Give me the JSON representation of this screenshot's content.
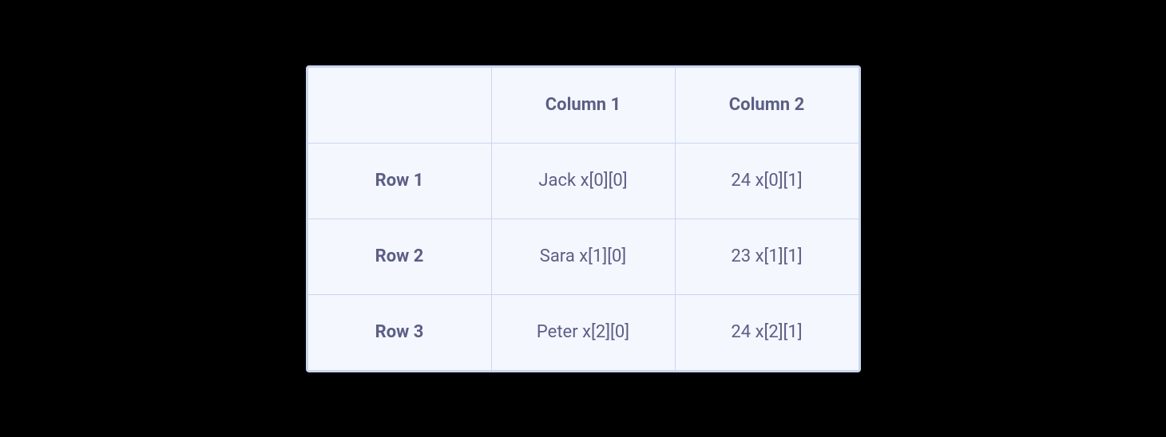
{
  "table": {
    "columns": [
      "Column 1",
      "Column 2"
    ],
    "rows": [
      {
        "label": "Row 1",
        "cells": [
          "Jack x[0][0]",
          "24 x[0][1]"
        ]
      },
      {
        "label": "Row 2",
        "cells": [
          "Sara x[1][0]",
          "23 x[1][1]"
        ]
      },
      {
        "label": "Row 3",
        "cells": [
          "Peter x[2][0]",
          "24 x[2][1]"
        ]
      }
    ]
  }
}
